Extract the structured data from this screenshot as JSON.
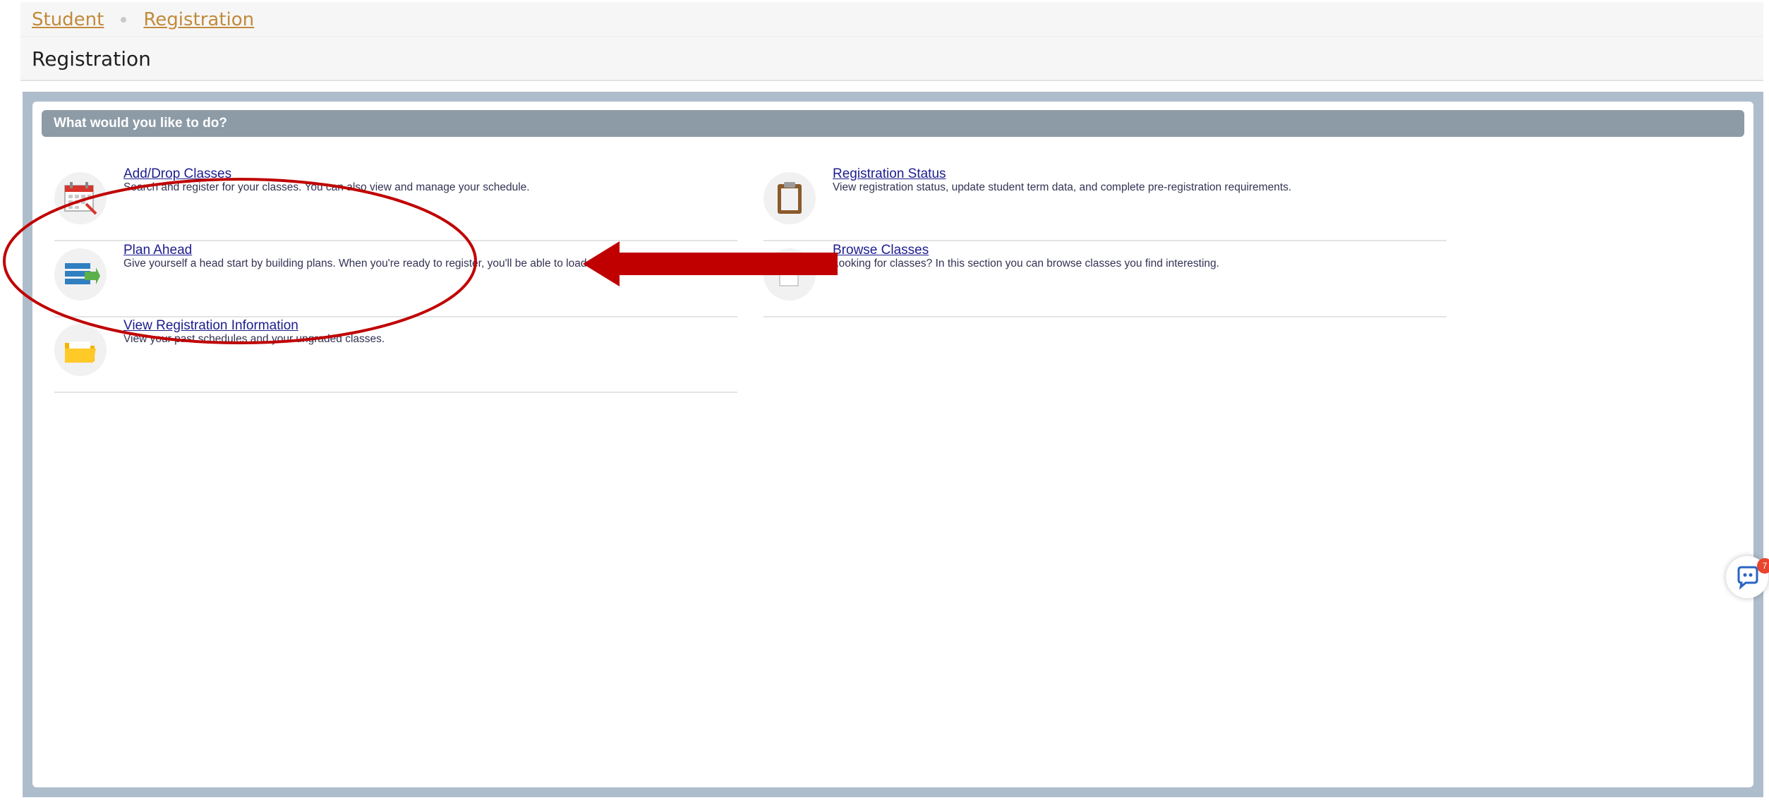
{
  "breadcrumb": {
    "items": [
      {
        "label": "Student"
      },
      {
        "label": "Registration"
      }
    ]
  },
  "page": {
    "title": "Registration"
  },
  "panel": {
    "header": "What would you like to do?",
    "actions": [
      {
        "title": "Add/Drop Classes",
        "description": "Search and register for your classes. You can also view and manage your schedule.",
        "icon": "calendar-icon"
      },
      {
        "title": "Registration Status",
        "description": "View registration status, update student term data, and complete pre-registration requirements.",
        "icon": "clipboard-icon"
      },
      {
        "title": "Plan Ahead",
        "description": "Give yourself a head start by building plans. When you're ready to register, you'll be able to load th",
        "icon": "plan-list-icon"
      },
      {
        "title": "Browse Classes",
        "description": "Looking for classes? In this section you can browse classes you find interesting.",
        "icon": "document-icon"
      },
      {
        "title": "View Registration Information",
        "description": "View your past schedules and your ungraded classes.",
        "icon": "folder-icon"
      }
    ]
  },
  "chat": {
    "icon": "chat-bubble-icon",
    "badge": "7"
  },
  "colors": {
    "accent_link": "#1d1d8f",
    "breadcrumb": "#c38a3b",
    "header_bg": "#8d9ba6",
    "frame_bg": "#aebdcc",
    "annotation": "#c00000"
  }
}
